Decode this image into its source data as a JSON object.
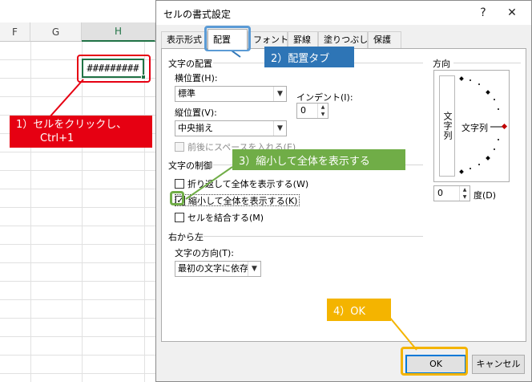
{
  "sheet": {
    "columns": [
      "F",
      "G",
      "H"
    ],
    "active_cell_value": "#########"
  },
  "dialog": {
    "title": "セルの書式設定",
    "help": "?",
    "close": "✕",
    "tabs": [
      "表示形式",
      "配置",
      "フォント",
      "罫線",
      "塗りつぶし",
      "保護"
    ],
    "alignment": {
      "section": "文字の配置",
      "horizontal_label": "横位置(H):",
      "horizontal_value": "標準",
      "vertical_label": "縦位置(V):",
      "vertical_value": "中央揃え",
      "indent_label": "インデント(I):",
      "indent_value": "0",
      "distributed_label": "前後にスペースを入れる(E)"
    },
    "control": {
      "section": "文字の制御",
      "wrap_label": "折り返して全体を表示する(W)",
      "shrink_label": "縮小して全体を表示する(K)",
      "merge_label": "セルを結合する(M)",
      "shrink_checked": true
    },
    "rtl": {
      "section": "右から左",
      "direction_label": "文字の方向(T):",
      "direction_value": "最初の文字に依存"
    },
    "orientation": {
      "section": "方向",
      "vertical_text": "文字列",
      "horizontal_text": "文字列",
      "degree_value": "0",
      "degree_label": "度(D)"
    },
    "ok": "OK",
    "cancel": "キャンセル"
  },
  "callouts": {
    "c1_line1": "1）セルをクリックし、",
    "c1_line2": "Ctrl+1",
    "c2": "2）配置タブ",
    "c3": "3）縮小して全体を表示する",
    "c4": "4）OK"
  },
  "colors": {
    "excel_green": "#217346",
    "callout_red": "#e60012",
    "callout_blue": "#2e75b6",
    "callout_green": "#70ad47",
    "callout_yellow": "#f4b400"
  }
}
